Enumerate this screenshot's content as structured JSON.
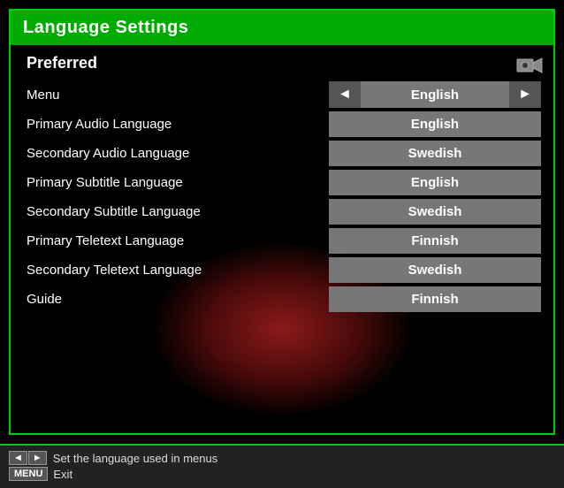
{
  "title": "Language Settings",
  "preferred_label": "Preferred",
  "rows": [
    {
      "label": "Menu",
      "value": "English",
      "has_arrows": true
    },
    {
      "label": "Primary Audio Language",
      "value": "English",
      "has_arrows": false
    },
    {
      "label": "Secondary Audio Language",
      "value": "Swedish",
      "has_arrows": false
    },
    {
      "label": "Primary Subtitle Language",
      "value": "English",
      "has_arrows": false
    },
    {
      "label": "Secondary Subtitle Language",
      "value": "Swedish",
      "has_arrows": false
    },
    {
      "label": "Primary Teletext Language",
      "value": "Finnish",
      "has_arrows": false
    },
    {
      "label": "Secondary Teletext Language",
      "value": "Swedish",
      "has_arrows": false
    },
    {
      "label": "Guide",
      "value": "Finnish",
      "has_arrows": false
    }
  ],
  "hints": [
    {
      "badge": "◄►",
      "text": "Set the language used in menus"
    },
    {
      "badge": "MENU",
      "text": "Exit"
    }
  ],
  "colors": {
    "accent": "#00cc00",
    "title_bg": "#00aa00"
  }
}
